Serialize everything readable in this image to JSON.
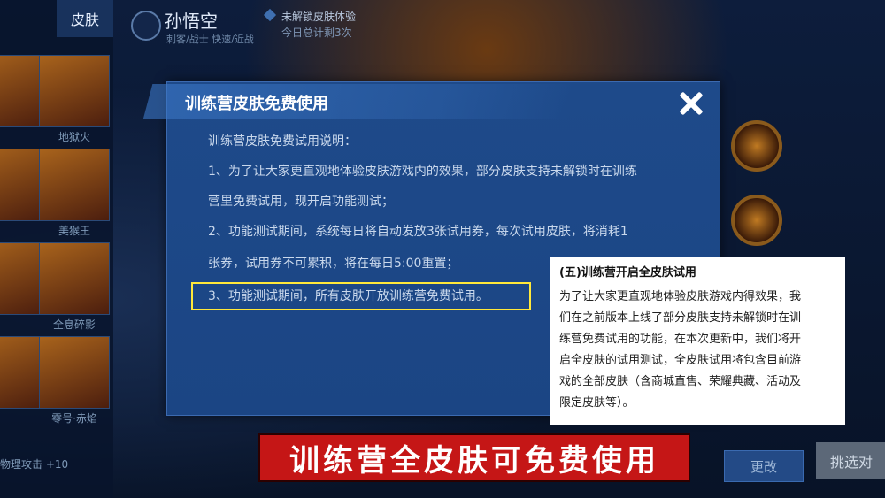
{
  "sidebar": {
    "tabs": [
      "",
      "皮肤"
    ],
    "skin_names": [
      "",
      "地狱火",
      "",
      "美猴王",
      "",
      "全息碎影",
      "",
      "零号·赤焰"
    ],
    "bottom_text": "物理攻击 +10"
  },
  "header": {
    "hero_name": "孙悟空",
    "hero_sub": "刺客/战士  快速/近战",
    "skin_status": "未解锁皮肤体验",
    "remaining": "今日总计剩3次"
  },
  "dialog": {
    "title": "训练营皮肤免费使用",
    "lines": [
      "训练营皮肤免费试用说明：",
      "1、为了让大家更直观地体验皮肤游戏内的效果，部分皮肤支持未解锁时在训练",
      "营里免费试用，现开启功能测试；",
      "2、功能测试期间，系统每日将自动发放3张试用券，每次试用皮肤，将消耗1",
      "张券，试用券不可累积，将在每日5:00重置；",
      "3、功能测试期间，所有皮肤开放训练营免费试用。"
    ]
  },
  "note": {
    "title": "(五)训练营开启全皮肤试用",
    "lines": [
      "为了让大家更直观地体验皮肤游戏内得效果，我",
      "们在之前版本上线了部分皮肤支持未解锁时在训",
      "练营免费试用的功能，在本次更新中，我们将开",
      "启全皮肤的试用测试，全皮肤试用将包含目前游",
      "戏的全部皮肤（含商城直售、荣耀典藏、活动及",
      "限定皮肤等）。"
    ]
  },
  "buttons": {
    "change": "更改",
    "pick": "挑选对"
  },
  "banner": "训练营全皮肤可免费使用",
  "colors": {
    "highlight": "#ffe83a",
    "banner_bg": "#c51616",
    "panel_bg": "#1e4a8a"
  }
}
